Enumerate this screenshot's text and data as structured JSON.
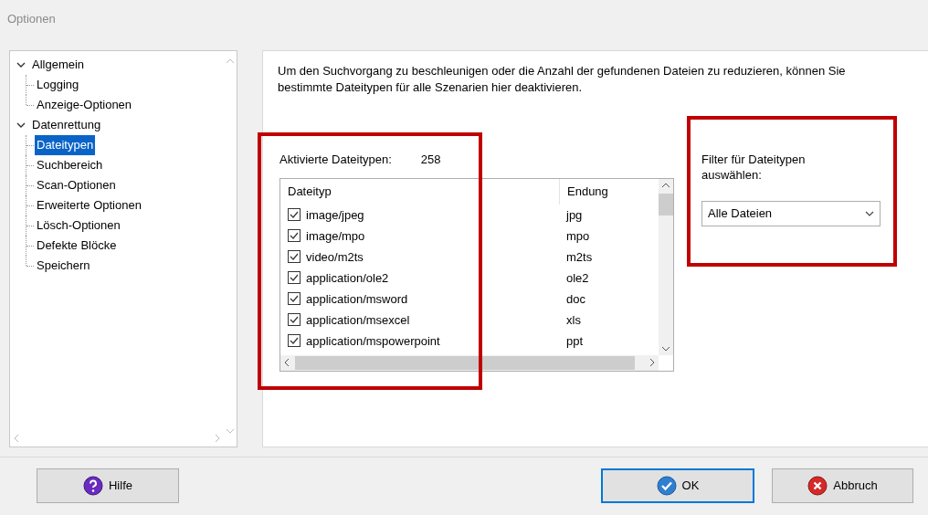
{
  "window": {
    "title": "Optionen"
  },
  "tree": [
    {
      "label": "Allgemein",
      "expanded": true,
      "selected": false,
      "children": [
        {
          "label": "Logging",
          "selected": false
        },
        {
          "label": "Anzeige-Optionen",
          "selected": false
        }
      ]
    },
    {
      "label": "Datenrettung",
      "expanded": true,
      "selected": false,
      "children": [
        {
          "label": "Dateitypen",
          "selected": true
        },
        {
          "label": "Suchbereich",
          "selected": false
        },
        {
          "label": "Scan-Optionen",
          "selected": false
        },
        {
          "label": "Erweiterte Optionen",
          "selected": false
        },
        {
          "label": "Lösch-Optionen",
          "selected": false
        },
        {
          "label": "Defekte Blöcke",
          "selected": false
        },
        {
          "label": "Speichern",
          "selected": false
        }
      ]
    }
  ],
  "description": "Um den Suchvorgang zu beschleunigen oder die Anzahl der gefundenen Dateien zu reduzieren, können Sie bestimmte Dateitypen für alle Szenarien hier deaktivieren.",
  "active_count": {
    "label": "Aktivierte Dateitypen:",
    "value": "258"
  },
  "table": {
    "columns": [
      "Dateityp",
      "Endung"
    ],
    "rows": [
      {
        "checked": true,
        "type": "image/jpeg",
        "ext": "jpg"
      },
      {
        "checked": true,
        "type": "image/mpo",
        "ext": "mpo"
      },
      {
        "checked": true,
        "type": "video/m2ts",
        "ext": "m2ts"
      },
      {
        "checked": true,
        "type": "application/ole2",
        "ext": "ole2"
      },
      {
        "checked": true,
        "type": "application/msword",
        "ext": "doc"
      },
      {
        "checked": true,
        "type": "application/msexcel",
        "ext": "xls"
      },
      {
        "checked": true,
        "type": "application/mspowerpoint",
        "ext": "ppt"
      }
    ]
  },
  "filter": {
    "label": "Filter für Dateitypen auswählen:",
    "value": "Alle Dateien"
  },
  "buttons": [
    {
      "label": "Hilfe",
      "kind": "help",
      "default": false
    },
    {
      "label": "OK",
      "kind": "ok",
      "default": true
    },
    {
      "label": "Abbruch",
      "kind": "cancel",
      "default": false
    }
  ]
}
